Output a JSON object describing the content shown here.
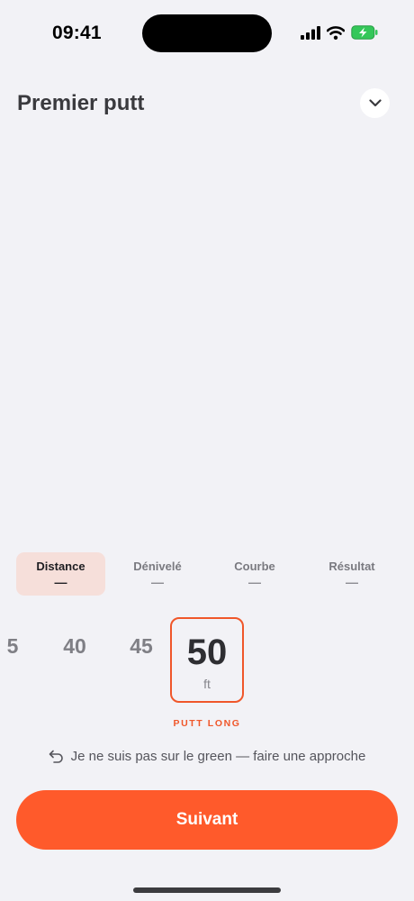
{
  "status_bar": {
    "time": "09:41"
  },
  "header": {
    "title": "Premier putt"
  },
  "tabs": [
    {
      "label": "Distance",
      "value": "—",
      "active": true
    },
    {
      "label": "Dénivelé",
      "value": "—",
      "active": false
    },
    {
      "label": "Courbe",
      "value": "—",
      "active": false
    },
    {
      "label": "Résultat",
      "value": "—",
      "active": false
    }
  ],
  "distance_picker": {
    "options": [
      "5",
      "40",
      "45"
    ],
    "selected_value": "50",
    "unit": "ft",
    "category_label": "PUTT LONG"
  },
  "approach_link": {
    "label": "Je ne suis pas sur le green — faire une approche"
  },
  "next_button": {
    "label": "Suivant"
  },
  "colors": {
    "accent": "#ff5a2b",
    "background": "#f2f2f6",
    "active_tab": "#f6dfda"
  }
}
